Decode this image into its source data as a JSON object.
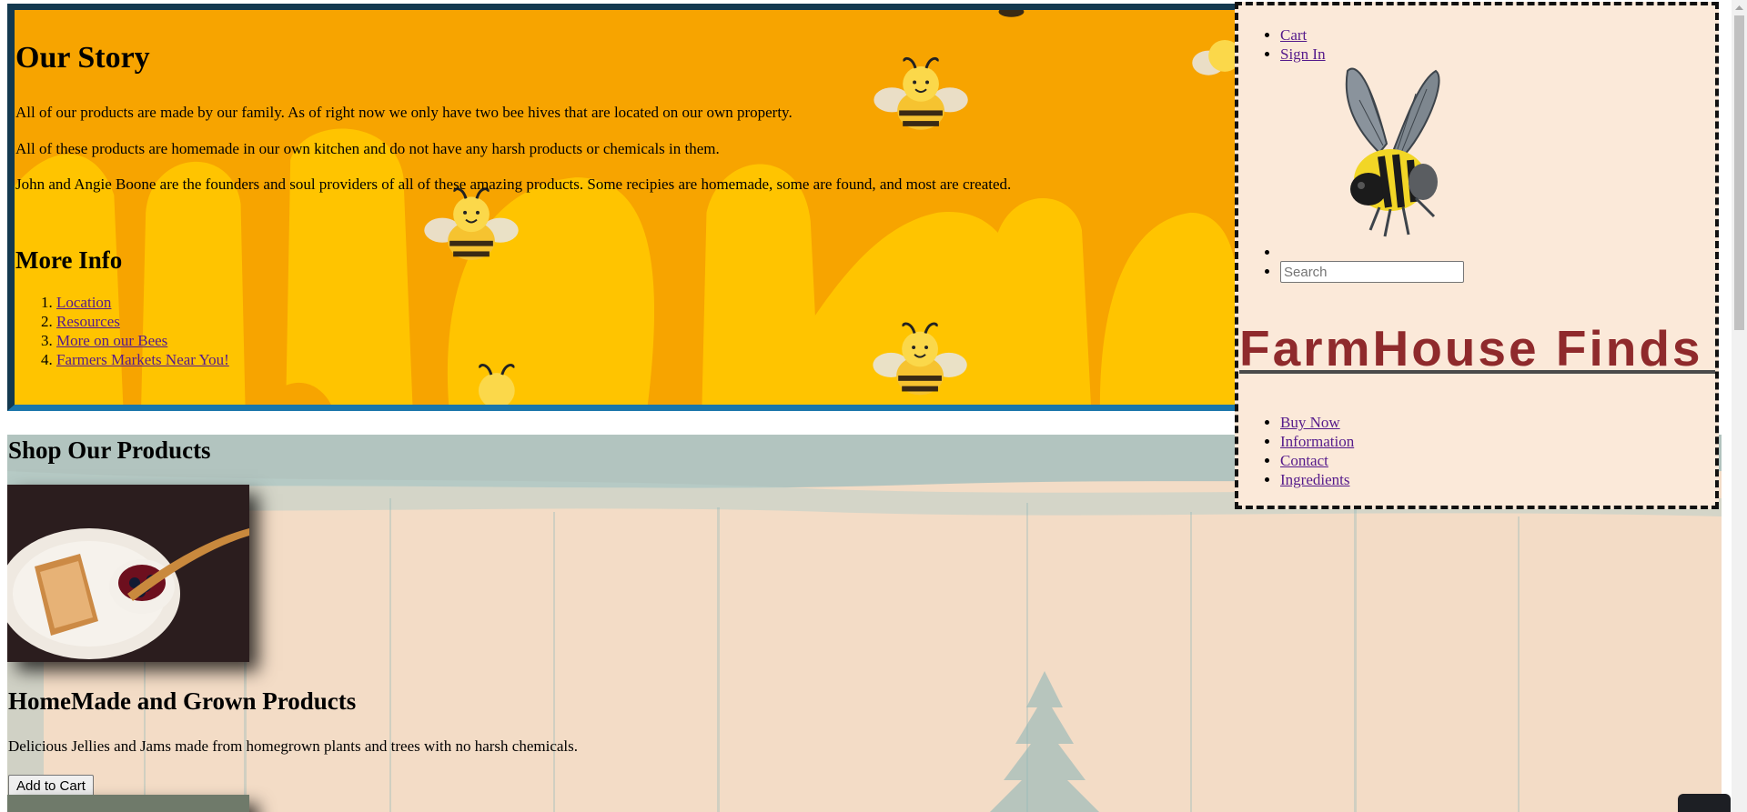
{
  "story": {
    "heading": "Our Story",
    "paragraphs": [
      "All of our products are made by our family. As of right now we only have two bee hives that are located on our own property.",
      "All of these products are homemade in our own kitchen and do not have any harsh products or chemicals in them.",
      "John and Angie Boone are the founders and soul providers of all of these amazing products. Some recipies are homemade, some are found, and most are created."
    ],
    "more_info_heading": "More Info",
    "more_info_links": [
      "Location",
      "Resources",
      "More on our Bees",
      "Farmers Markets Near You!"
    ]
  },
  "shop": {
    "heading": "Shop Our Products",
    "product": {
      "title": "HomeMade and Grown Products",
      "description": "Delicious Jellies and Jams made from homegrown plants and trees with no harsh chemicals.",
      "button_label": "Add to Cart"
    }
  },
  "header": {
    "top_links": [
      "Cart",
      "Sign In"
    ],
    "search_placeholder": "Search",
    "brand": "FarmHouse Finds",
    "nav_links": [
      "Buy Now",
      "Information",
      "Contact",
      "Ingredients"
    ]
  },
  "colors": {
    "story_bg": "#f7a400",
    "honey_drip": "#ffc400",
    "header_bg": "#fbe9d9",
    "brand": "#8f2a2c",
    "link": "#551a8b"
  },
  "icons": {
    "logo": "bee-icon",
    "decor": "cartoon-bee-icon"
  }
}
